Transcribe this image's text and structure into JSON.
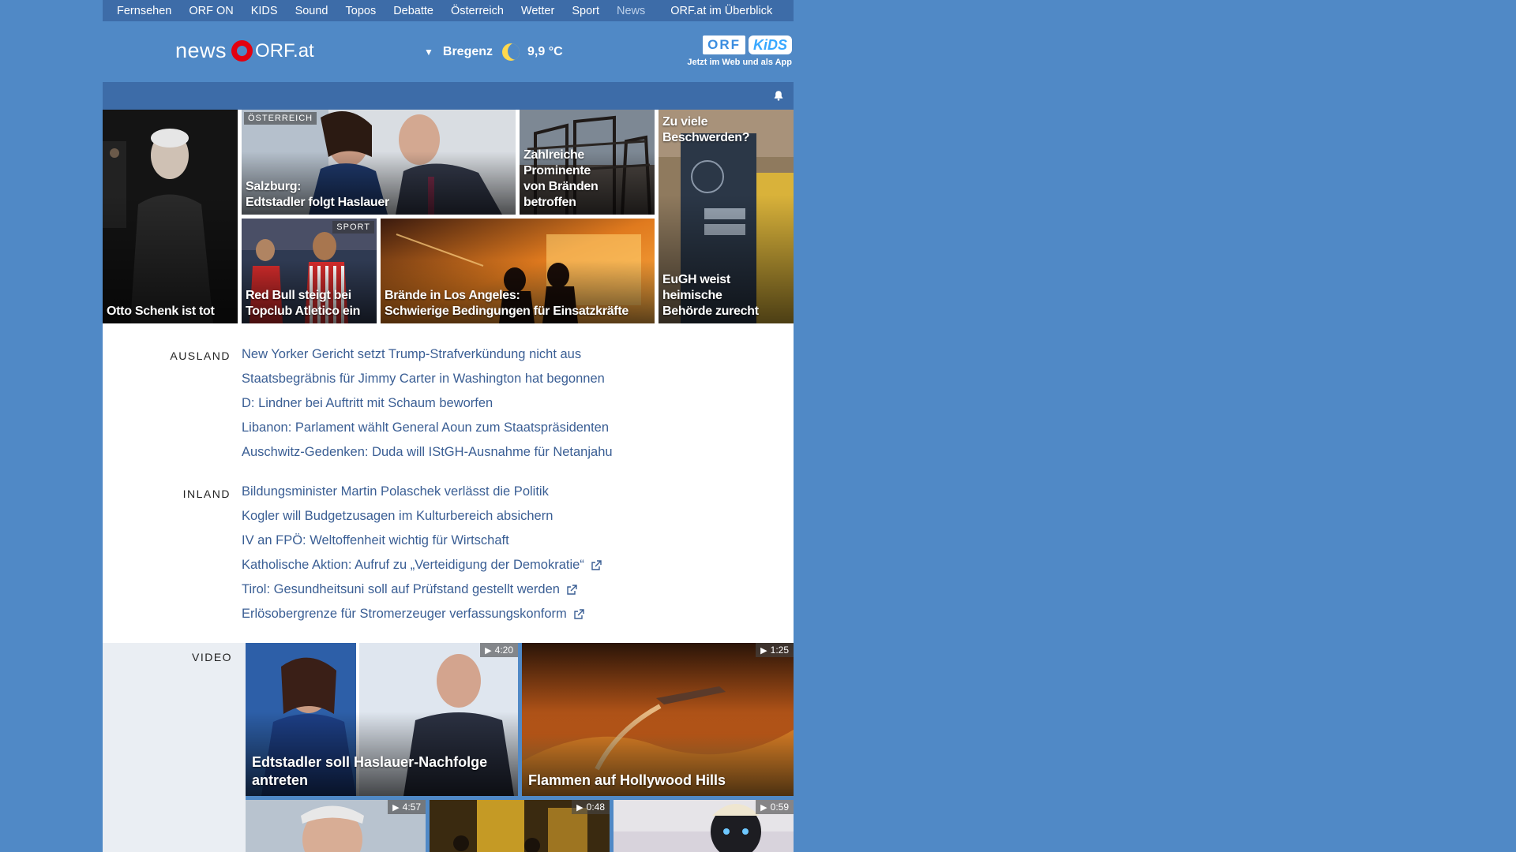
{
  "topnav": {
    "items": [
      "Fernsehen",
      "ORF ON",
      "KIDS",
      "Sound",
      "Topos",
      "Debatte",
      "Österreich",
      "Wetter",
      "Sport",
      "News"
    ],
    "active": "News",
    "overview": "ORF.at im Überblick"
  },
  "header": {
    "logo_news": "news",
    "logo_orf": "ORF.at",
    "weather": {
      "city": "Bregenz",
      "temperature": "9,9 °C",
      "icon": "moon-icon"
    },
    "kids_promo": {
      "badge_orf": "ORF",
      "badge_kids": "KiDS",
      "tagline": "Jetzt im Web und als App"
    }
  },
  "teasers": {
    "schenk": {
      "title": "Otto Schenk ist tot"
    },
    "salzburg": {
      "tag": "ÖSTERREICH",
      "title_line1": "Salzburg:",
      "title_line2": "Edtstadler folgt Haslauer"
    },
    "prominente": {
      "title_line1": "Zahlreiche Prominente",
      "title_line2": "von Bränden betroffen"
    },
    "eugh": {
      "title_top": "Zu viele Beschwerden?",
      "title_line1": "EuGH weist heimische",
      "title_line2": "Behörde zurecht"
    },
    "redbull": {
      "tag": "SPORT",
      "title_line1": "Red Bull steigt bei",
      "title_line2": "Topclub Atletico ein"
    },
    "la": {
      "title_line1": "Brände in Los Angeles:",
      "title_line2": "Schwierige Bedingungen für Einsatzkräfte"
    }
  },
  "ausland": {
    "label": "AUSLAND",
    "items": [
      "New Yorker Gericht setzt Trump-Strafverkündung nicht aus",
      "Staatsbegräbnis für Jimmy Carter in Washington hat begonnen",
      "D: Lindner bei Auftritt mit Schaum beworfen",
      "Libanon: Parlament wählt General Aoun zum Staatspräsidenten",
      "Auschwitz-Gedenken: Duda will IStGH-Ausnahme für Netanjahu"
    ]
  },
  "inland": {
    "label": "INLAND",
    "items": [
      "Bildungsminister Martin Polaschek verlässt die Politik",
      "Kogler will Budgetzusagen im Kulturbereich absichern",
      "IV an FPÖ: Weltoffenheit wichtig für Wirtschaft",
      "Katholische Aktion: Aufruf zu „Verteidigung der Demokratie“",
      "Tirol: Gesundheitsuni soll auf Prüfstand gestellt werden",
      "Erlösobergrenze für Stromerzeuger verfassungskonform"
    ],
    "external": [
      false,
      false,
      false,
      true,
      true,
      true
    ]
  },
  "video": {
    "label": "VIDEO",
    "tiles": [
      {
        "title_line1": "Edtstadler soll Haslauer-Nachfolge",
        "title_line2": "antreten",
        "duration": "4:20"
      },
      {
        "title_line1": "Flammen auf Hollywood Hills",
        "title_line2": "",
        "duration": "1:25"
      },
      {
        "title_line1": "",
        "title_line2": "",
        "duration": "4:57"
      },
      {
        "title_line1": "",
        "title_line2": "",
        "duration": "0:48"
      },
      {
        "title_line1": "",
        "title_line2": "",
        "duration": "0:59"
      }
    ]
  },
  "colors": {
    "page_bg": "#5089c6",
    "nav_bar": "#3d6ca8",
    "link": "#3a5e94",
    "brand_red": "#e3000f"
  }
}
